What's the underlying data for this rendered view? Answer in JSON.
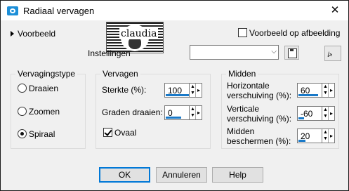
{
  "window": {
    "title": "Radiaal vervagen",
    "close_glyph": "✕"
  },
  "preview": {
    "toggle_label": "Voorbeeld",
    "checkbox_label": "Voorbeeld op afbeelding",
    "checkbox_checked": false,
    "thumbnail_text": "claudia"
  },
  "settings": {
    "label": "Instellingen",
    "value": ""
  },
  "vervagingstype": {
    "title": "Vervagingstype",
    "options": [
      "Draaien",
      "Zoomen",
      "Spiraal"
    ],
    "selected": "Spiraal"
  },
  "vervagen": {
    "title": "Vervagen",
    "strength_label": "Sterkte (%):",
    "strength_value": "100",
    "angle_label": "Graden draaien:",
    "angle_value": "0",
    "oval_label": "Ovaal",
    "oval_checked": true
  },
  "midden": {
    "title": "Midden",
    "h_label_1": "Horizontale",
    "h_label_2": "verschuiving (%):",
    "h_value": "60",
    "v_label_1": "Verticale",
    "v_label_2": "verschuiving (%):",
    "v_value": "-60",
    "p_label_1": "Midden",
    "p_label_2": "beschermen (%):",
    "p_value": "20"
  },
  "buttons": {
    "ok": "OK",
    "cancel": "Annuleren",
    "help": "Help"
  },
  "icons": {
    "app": "camera-icon",
    "expand": "triangle-right-icon",
    "save": "floppy-disk-icon",
    "reset": "reset-icon"
  },
  "colors": {
    "accent": "#0078d7",
    "slider_bar": "#1979c8",
    "title_icon": "#1d8fd8"
  }
}
